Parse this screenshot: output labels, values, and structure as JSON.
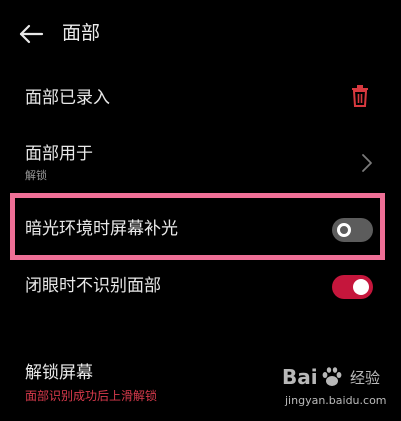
{
  "header": {
    "back_icon": "back-arrow-icon",
    "title": "面部"
  },
  "rows": {
    "face_enrolled": {
      "title": "面部已录入",
      "action_icon": "trash-icon"
    },
    "face_usage": {
      "title": "面部用于",
      "subtitle": "解锁",
      "action_icon": "chevron-right-icon"
    },
    "low_light_fill": {
      "title": "暗光环境时屏幕补光",
      "toggle_on": false
    },
    "eyes_closed": {
      "title": "闭眼时不识别面部",
      "toggle_on": true
    },
    "unlock_screen": {
      "title": "解锁屏幕",
      "subtitle": "面部识别成功后上滑解锁"
    }
  },
  "colors": {
    "accent": "#c5163c",
    "trash": "#d8393f",
    "highlight_border": "#ee6f96",
    "toggle_off": "#5c5c5c",
    "subtitle_red": "#d83a4c",
    "background": "#000000"
  },
  "watermark": {
    "logo_text": "Bai",
    "logo_text_2": "经验",
    "url": "jingyan.baidu.com"
  }
}
